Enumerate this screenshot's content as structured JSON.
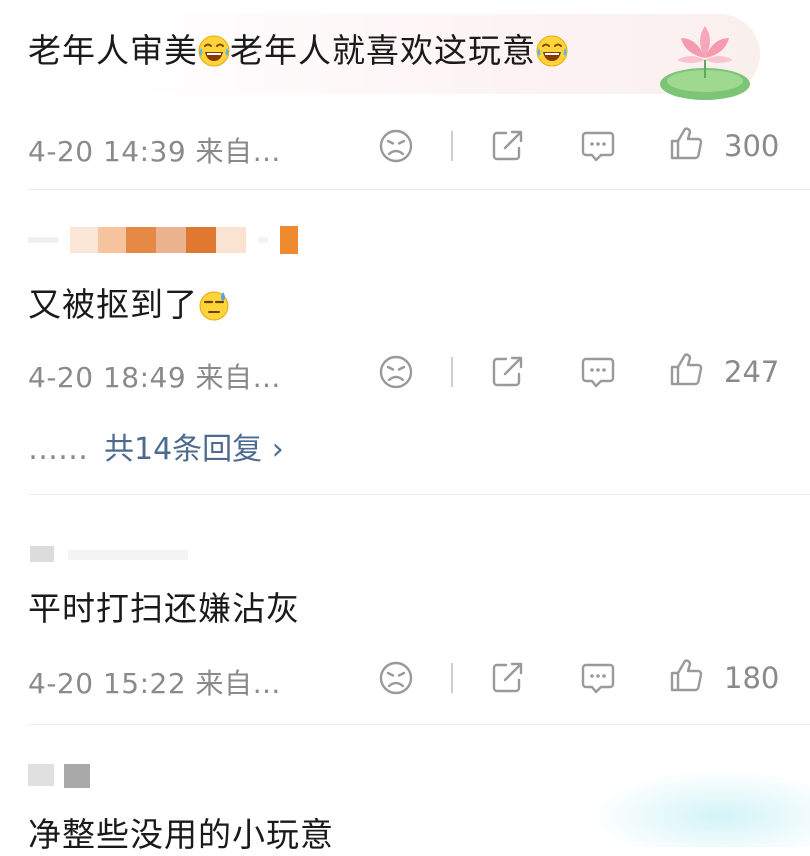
{
  "comments": [
    {
      "text_a": "老年人审美",
      "text_b": "老年人就喜欢这玩意",
      "meta": "4-20 14:39 来自…",
      "likes": "300",
      "emoji": "laugh-cry"
    },
    {
      "text": "又被抠到了",
      "meta": "4-20 18:49 来自…",
      "likes": "247",
      "emoji": "sweat",
      "replies_dots": "……",
      "replies_label": "共14条回复 ›"
    },
    {
      "text": "平时打扫还嫌沾灰",
      "meta": "4-20 15:22 来自…",
      "likes": "180"
    },
    {
      "text": "净整些没用的小玩意"
    }
  ],
  "colors": {
    "text": "#1a1a1a",
    "meta": "#8a8a8a",
    "reply_link": "#4d6b8e",
    "icon": "#9a9a9a"
  },
  "icons": [
    "dislike-face-icon",
    "share-icon",
    "comment-icon",
    "thumbs-up-icon"
  ]
}
